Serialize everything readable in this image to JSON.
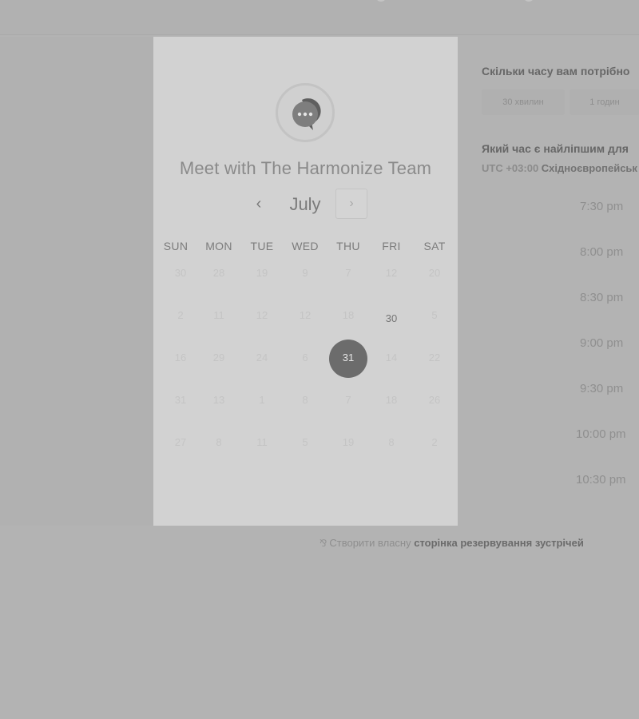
{
  "card": {
    "title": "Meet with The Harmonize Team",
    "avatar_icon": "chat-bubble-icon"
  },
  "calendar": {
    "month": "July",
    "prev_icon": "‹",
    "next_icon": "›",
    "weekdays": [
      "SUN",
      "MON",
      "TUE",
      "WED",
      "THU",
      "FRI",
      "SAT"
    ],
    "weeks": [
      [
        "30",
        "28",
        "19",
        "9",
        "7",
        "12",
        "20"
      ],
      [
        "2",
        "11",
        "12",
        "12",
        "18",
        "30",
        "5"
      ],
      [
        "16",
        "29",
        "24",
        "6",
        "31",
        "14",
        "22"
      ],
      [
        "31",
        "13",
        "1",
        "8",
        "7",
        "18",
        "26"
      ],
      [
        "27",
        "8",
        "11",
        "5",
        "19",
        "8",
        "2"
      ]
    ],
    "available_day": "30",
    "selected_day": "31"
  },
  "booking": {
    "duration_question": "Скільки часу вам потрібно",
    "durations": [
      "30 хвилин",
      "1 годин"
    ],
    "time_question": "Який час є найліпшим для",
    "tz_offset": "UTC +03:00",
    "tz_name": "Східноєвропейськ",
    "slots": [
      "7:30 pm",
      "8:00 pm",
      "8:30 pm",
      "9:00 pm",
      "9:30 pm",
      "10:00 pm",
      "10:30 pm"
    ]
  },
  "footer": {
    "icon": "⅋",
    "prefix": "Створити власну",
    "link": "сторінка резервування зустрічей"
  }
}
